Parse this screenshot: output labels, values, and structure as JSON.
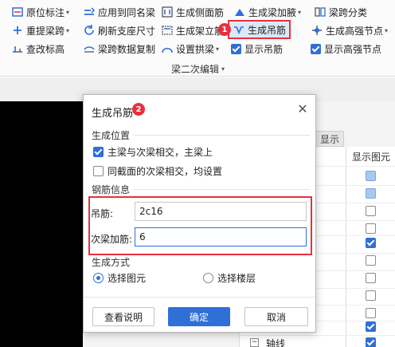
{
  "ribbon": {
    "items": [
      {
        "label": "原位标注",
        "dropdown": true,
        "icon": "annotation-icon"
      },
      {
        "label": "应用到同名梁",
        "dropdown": false,
        "icon": "apply-icon"
      },
      {
        "label": "生成侧面筋",
        "dropdown": false,
        "icon": "side-rebar-icon"
      },
      {
        "label": "生成梁加腋",
        "dropdown": true,
        "icon": "haunch-icon"
      },
      {
        "label": "梁跨分类",
        "dropdown": false,
        "icon": "span-classify-icon"
      },
      {
        "label": "重提梁跨",
        "dropdown": true,
        "icon": "respan-icon"
      },
      {
        "label": "刷新支座尺寸",
        "dropdown": false,
        "icon": "refresh-icon"
      },
      {
        "label": "生成架立筋",
        "dropdown": false,
        "icon": "erect-rebar-icon"
      },
      {
        "label": "生成吊筋",
        "dropdown": false,
        "icon": "hanger-rebar-icon"
      },
      {
        "label": "生成高强节点",
        "dropdown": true,
        "icon": "node-icon"
      },
      {
        "label": "查改标高",
        "dropdown": false,
        "icon": "elevation-icon"
      },
      {
        "label": "梁跨数据复制",
        "dropdown": false,
        "icon": "copy-icon"
      },
      {
        "label": "设置拱梁",
        "dropdown": true,
        "icon": "arch-icon"
      },
      {
        "label": "显示吊筋",
        "dropdown": false,
        "icon": "checkbox-icon"
      },
      {
        "label": "显示高强节点",
        "dropdown": false,
        "icon": "checkbox-icon"
      }
    ],
    "group_label": "梁二次编辑"
  },
  "badges": {
    "one": "1",
    "two": "2"
  },
  "background": {
    "tab_label": "显示",
    "column_header": "显示图元",
    "tree_toggle": "−",
    "tree_label": "轴线"
  },
  "dialog": {
    "title": "生成吊筋",
    "close": "✕",
    "section_position": "生成位置",
    "opt_main_secondary": "主梁与次梁相交，主梁上",
    "opt_same_section": "同截面的次梁相交，均设置",
    "section_rebar": "钢筋信息",
    "label_hanger": "吊筋:",
    "value_hanger": "2c16",
    "label_secondary": "次梁加筋:",
    "value_secondary": "6",
    "section_method": "生成方式",
    "radio_select_element": "选择图元",
    "radio_select_floor": "选择楼层",
    "btn_help": "查看说明",
    "btn_ok": "确定",
    "btn_cancel": "取消"
  },
  "colors": {
    "accent": "#2e6fd8",
    "highlight": "#e8303c"
  }
}
